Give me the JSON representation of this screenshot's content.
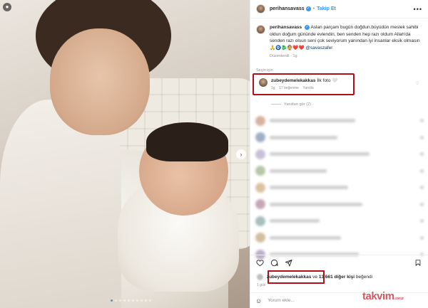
{
  "post": {
    "username": "perihansavass",
    "follow_label": "Takip Et",
    "more": "•••"
  },
  "caption": {
    "username": "perihansavass",
    "text": "Aslan parçam bugün doğdun.büyüdün meslek sahibi oldun doğum gününde evlendin, ben senden hep razı oldum Allah'da senden razı olsun seni çok seviyorum yanından iyi insanlar eksik olmasın 🙏🧿🐉👰❤️❤️",
    "mention": "@savaszafer",
    "edited": "Düzenlendi",
    "time": "1g"
  },
  "collapsed_row": "Seçin için",
  "highlighted_comment": {
    "username": "zubeydemelekakkas",
    "text": "İlk foto 🤍",
    "time": "1g",
    "likes": "17 beğenme",
    "reply": "Yanıtla"
  },
  "replies_toggle": "Yanıtları gör (2)",
  "blurred_colors": [
    "#d6b3a0",
    "#9fb0c4",
    "#c9c0d6",
    "#b8c7a6",
    "#d9c3a3",
    "#c4a8b7",
    "#a6c0bf",
    "#d1bfa0",
    "#bdb0c9"
  ],
  "likes": {
    "liker": "zubeydemelekakkas",
    "rest": "ve",
    "count_text": "13.661 diğer kişi",
    "suffix": "beğendi"
  },
  "timestamp": "1 gün",
  "composer": {
    "placeholder": "Yorum ekle..."
  },
  "watermark": {
    "brand": "takvim",
    "domain": ".com.tr"
  },
  "photo": {
    "slides": 10,
    "active_slide": 1
  }
}
